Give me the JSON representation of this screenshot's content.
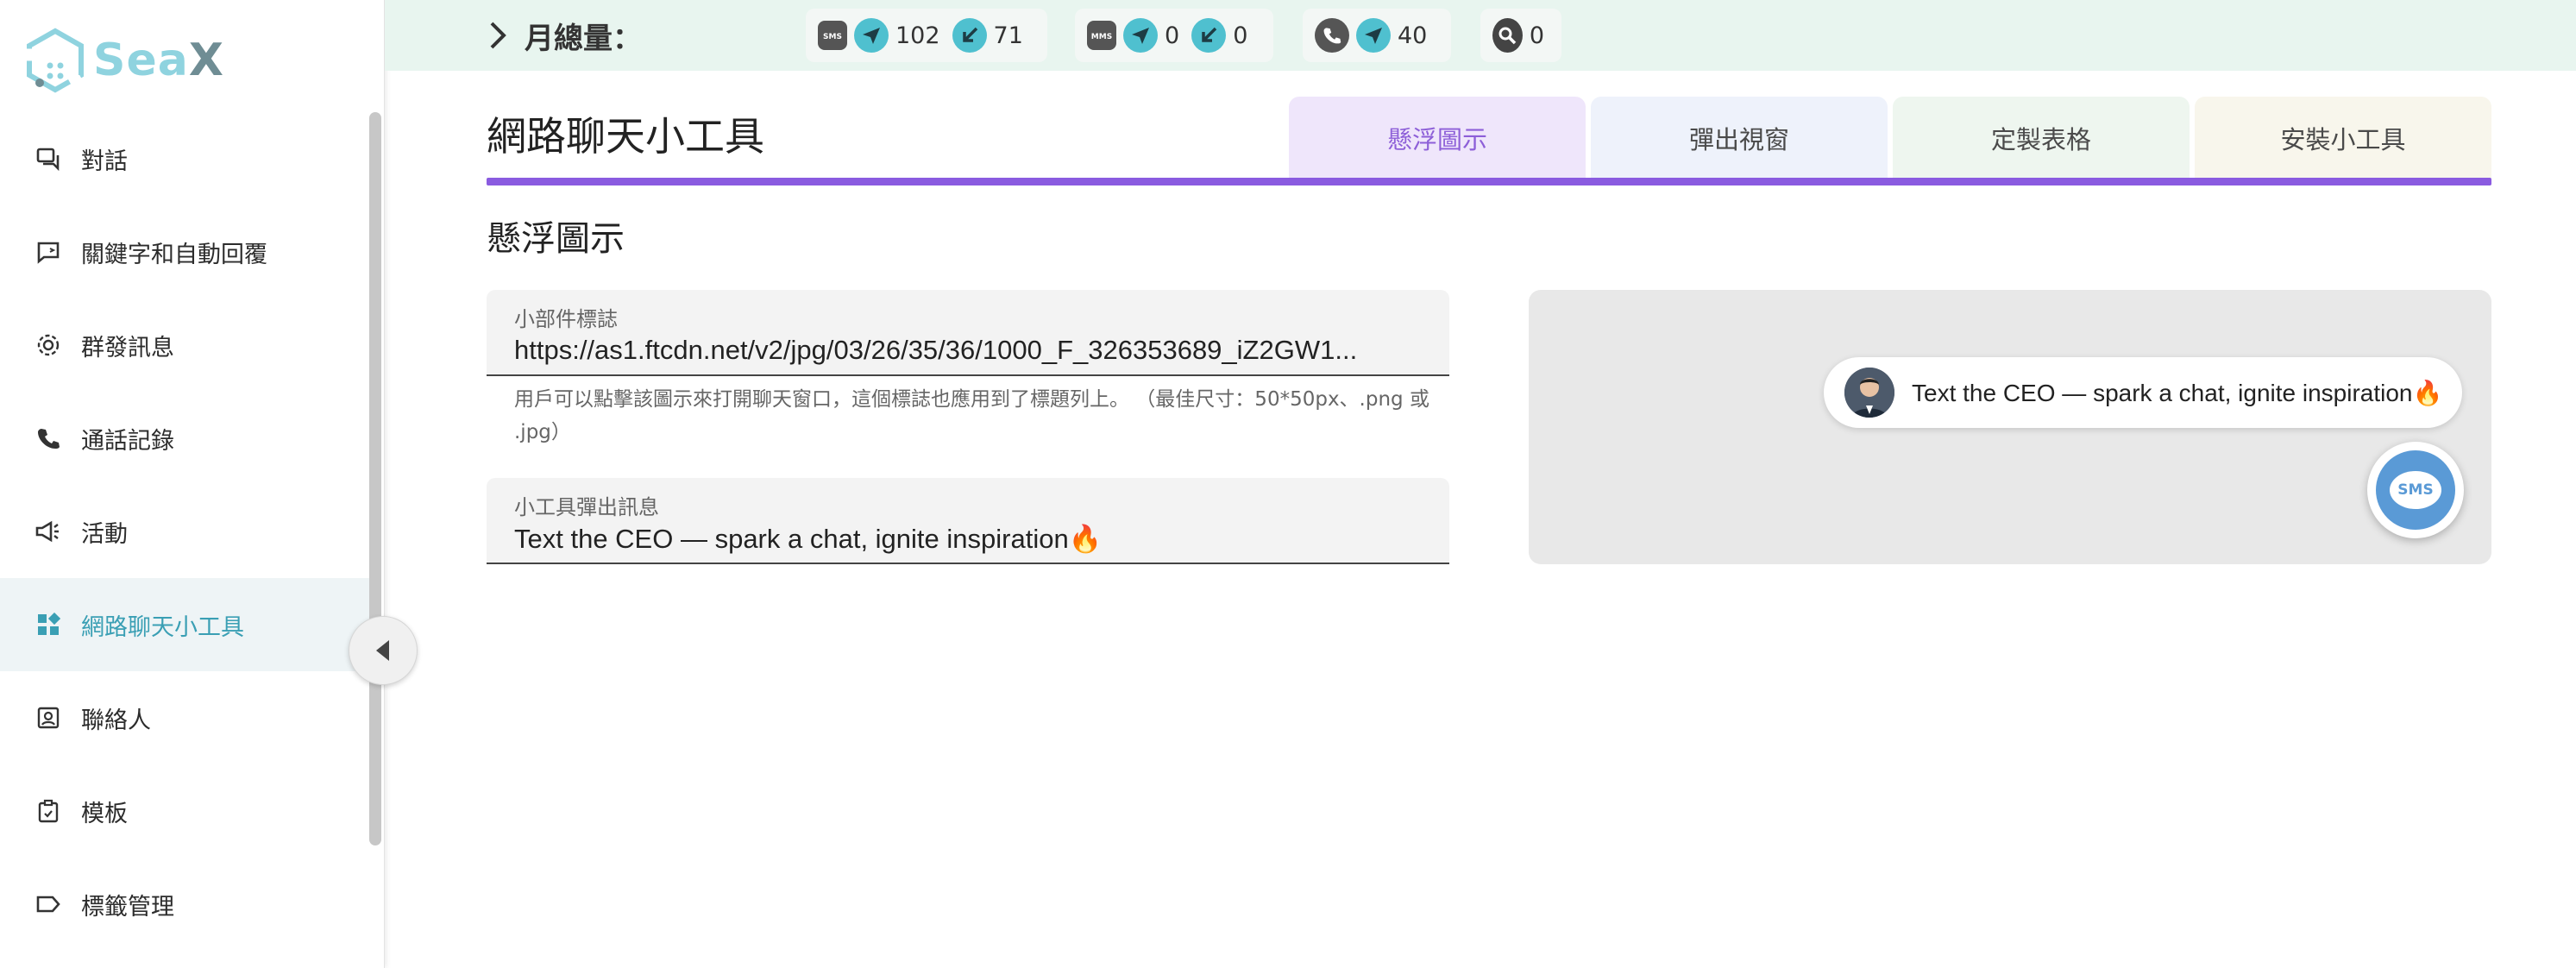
{
  "app": {
    "logo_sea": "Sea",
    "logo_x": "X"
  },
  "sidebar": {
    "items": [
      {
        "label": "對話",
        "icon": "chat-icon"
      },
      {
        "label": "關鍵字和自動回覆",
        "icon": "auto-reply-icon"
      },
      {
        "label": "群發訊息",
        "icon": "gear-icon"
      },
      {
        "label": "通話記錄",
        "icon": "phone-icon"
      },
      {
        "label": "活動",
        "icon": "megaphone-icon"
      },
      {
        "label": "網路聊天小工具",
        "icon": "widget-icon",
        "active": true
      },
      {
        "label": "聯絡人",
        "icon": "contact-icon"
      },
      {
        "label": "模板",
        "icon": "template-icon"
      },
      {
        "label": "標籤管理",
        "icon": "tag-icon"
      }
    ]
  },
  "topbar": {
    "month_label": "月總量：",
    "sms": {
      "sent": "102",
      "received": "71"
    },
    "mms": {
      "sent": "0",
      "received": "0"
    },
    "call": {
      "sent": "40"
    },
    "search": {
      "count": "0"
    }
  },
  "main": {
    "page_title": "網路聊天小工具",
    "tabs": [
      "懸浮圖示",
      "彈出視窗",
      "定製表格",
      "安裝小工具"
    ],
    "section_title": "懸浮圖示",
    "logo_field": {
      "label": "小部件標誌",
      "value": "https://as1.ftcdn.net/v2/jpg/03/26/35/36/1000_F_326353689_iZ2GW1..."
    },
    "helper_text": "用戶可以點擊該圖示來打開聊天窗口，這個標誌也應用到了標題列上。 （最佳尺寸：50*50px、.png 或 .jpg）",
    "popup_field": {
      "label": "小工具彈出訊息",
      "value": "Text the CEO — spark a chat, ignite inspiration🔥"
    },
    "preview": {
      "bubble_text": "Text the CEO — spark a chat, ignite inspiration🔥",
      "sms_label": "SMS"
    }
  },
  "colors": {
    "accent": "#8a5be0",
    "brand": "#3a9fb4",
    "topbar_bg": "#e8f5ef",
    "sms_blue": "#5a9ad6"
  }
}
